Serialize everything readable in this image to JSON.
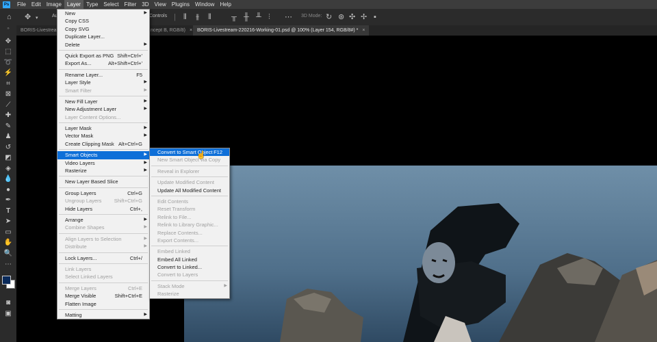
{
  "menubar": [
    "File",
    "Edit",
    "Image",
    "Layer",
    "Type",
    "Select",
    "Filter",
    "3D",
    "View",
    "Plugins",
    "Window",
    "Help"
  ],
  "options": {
    "auto_select": "Au",
    "controls": "Controls",
    "mode_3d": "3D Mode:"
  },
  "tabs": [
    {
      "label": "BORIS-Livestream"
    },
    {
      "label": "ncept B, RGB/8)"
    },
    {
      "label": "BORIS-Livestream-220216-Working-01.psd @ 100% (Layer 154, RGB/8#) *"
    }
  ],
  "layer_menu": [
    {
      "label": "New",
      "arrow": true
    },
    {
      "label": "Copy CSS"
    },
    {
      "label": "Copy SVG"
    },
    {
      "label": "Duplicate Layer..."
    },
    {
      "label": "Delete",
      "arrow": true
    },
    {
      "sep": true
    },
    {
      "label": "Quick Export as PNG",
      "shortcut": "Shift+Ctrl+'"
    },
    {
      "label": "Export As...",
      "shortcut": "Alt+Shift+Ctrl+'"
    },
    {
      "sep": true
    },
    {
      "label": "Rename Layer...",
      "shortcut": "F5"
    },
    {
      "label": "Layer Style",
      "arrow": true
    },
    {
      "label": "Smart Filter",
      "arrow": true,
      "disabled": true
    },
    {
      "sep": true
    },
    {
      "label": "New Fill Layer",
      "arrow": true
    },
    {
      "label": "New Adjustment Layer",
      "arrow": true
    },
    {
      "label": "Layer Content Options...",
      "disabled": true
    },
    {
      "sep": true
    },
    {
      "label": "Layer Mask",
      "arrow": true
    },
    {
      "label": "Vector Mask",
      "arrow": true
    },
    {
      "label": "Create Clipping Mask",
      "shortcut": "Alt+Ctrl+G"
    },
    {
      "sep": true
    },
    {
      "label": "Smart Objects",
      "arrow": true,
      "highlight": true
    },
    {
      "label": "Video Layers",
      "arrow": true
    },
    {
      "label": "Rasterize",
      "arrow": true
    },
    {
      "sep": true
    },
    {
      "label": "New Layer Based Slice"
    },
    {
      "sep": true
    },
    {
      "label": "Group Layers",
      "shortcut": "Ctrl+G"
    },
    {
      "label": "Ungroup Layers",
      "shortcut": "Shift+Ctrl+G",
      "disabled": true
    },
    {
      "label": "Hide Layers",
      "shortcut": "Ctrl+,"
    },
    {
      "sep": true
    },
    {
      "label": "Arrange",
      "arrow": true
    },
    {
      "label": "Combine Shapes",
      "arrow": true,
      "disabled": true
    },
    {
      "sep": true
    },
    {
      "label": "Align Layers to Selection",
      "arrow": true,
      "disabled": true
    },
    {
      "label": "Distribute",
      "arrow": true,
      "disabled": true
    },
    {
      "sep": true
    },
    {
      "label": "Lock Layers...",
      "shortcut": "Ctrl+/"
    },
    {
      "sep": true
    },
    {
      "label": "Link Layers",
      "disabled": true
    },
    {
      "label": "Select Linked Layers",
      "disabled": true
    },
    {
      "sep": true
    },
    {
      "label": "Merge Layers",
      "shortcut": "Ctrl+E",
      "disabled": true
    },
    {
      "label": "Merge Visible",
      "shortcut": "Shift+Ctrl+E"
    },
    {
      "label": "Flatten Image"
    },
    {
      "sep": true
    },
    {
      "label": "Matting",
      "arrow": true
    }
  ],
  "smart_objects_menu": [
    {
      "label": "Convert to Smart Object",
      "shortcut": "F12",
      "highlight": true
    },
    {
      "label": "New Smart Object via Copy",
      "disabled": true
    },
    {
      "sep": true
    },
    {
      "label": "Reveal in Explorer",
      "disabled": true
    },
    {
      "sep": true
    },
    {
      "label": "Update Modified Content",
      "disabled": true
    },
    {
      "label": "Update All Modified Content"
    },
    {
      "sep": true
    },
    {
      "label": "Edit Contents",
      "disabled": true
    },
    {
      "label": "Reset Transform",
      "disabled": true
    },
    {
      "label": "Relink to File...",
      "disabled": true
    },
    {
      "label": "Relink to Library Graphic...",
      "disabled": true
    },
    {
      "label": "Replace Contents...",
      "disabled": true
    },
    {
      "label": "Export Contents...",
      "disabled": true
    },
    {
      "sep": true
    },
    {
      "label": "Embed Linked",
      "disabled": true
    },
    {
      "label": "Embed All Linked"
    },
    {
      "label": "Convert to Linked..."
    },
    {
      "label": "Convert to Layers",
      "disabled": true
    },
    {
      "sep": true
    },
    {
      "label": "Stack Mode",
      "arrow": true,
      "disabled": true
    },
    {
      "label": "Rasterize",
      "disabled": true
    }
  ],
  "colors": {
    "highlight": "#0e6fd8",
    "menubar": "#3c3c3c",
    "panel": "#2b2b2b",
    "canvas": "#000000",
    "sky": "#5e7f9a"
  }
}
